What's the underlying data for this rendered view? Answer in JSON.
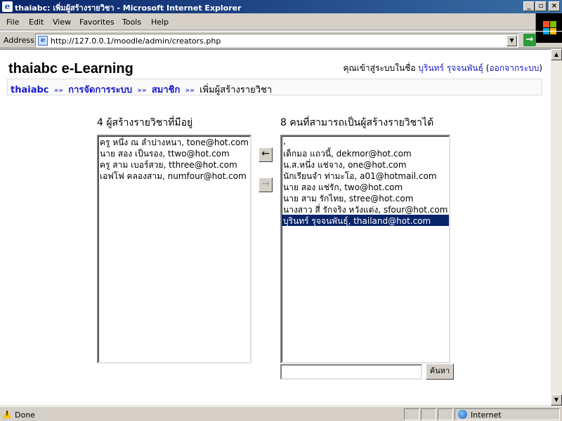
{
  "window": {
    "title": "thaiabc: เพิ่มผู้สร้างรายวิชา - Microsoft Internet Explorer",
    "minimize_glyph": "_",
    "maximize_glyph": "▫",
    "close_glyph": "×"
  },
  "menu": {
    "items": [
      "File",
      "Edit",
      "View",
      "Favorites",
      "Tools",
      "Help"
    ]
  },
  "address_bar": {
    "label": "Address",
    "url": "http://127.0.0.1/moodle/admin/creators.php",
    "go_label": "Go"
  },
  "page": {
    "site_title": "thaiabc e-Learning",
    "login": {
      "prefix": "คุณเข้าสู่ระบบในชื่อ",
      "user": "บุรินทร์ รุจจนพันธุ์",
      "logout": "ออกจากระบบ"
    },
    "breadcrumb": {
      "home": "thaiabc",
      "admin": "การจัดการระบบ",
      "users": "สมาชิก",
      "current": "เพิ่มผู้สร้างรายวิชา",
      "separator": "»»"
    },
    "existing": {
      "heading": "4 ผู้สร้างรายวิชาที่มีอยู่",
      "options": [
        "ครู หนึ่ง ณ ลำปางหนา, tone@hot.com",
        "นาย สอง เป็นรอง, ttwo@hot.com",
        "ครู สาม เบอร์สวย, tthree@hot.com",
        "เอฟโฟ คลองสาม, numfour@hot.com"
      ]
    },
    "potential": {
      "heading": "8 คนที่สามารถเป็นผู้สร้างรายวิชาได้",
      "options": [
        ",",
        "เด็กมอ แถวนี้, dekmor@hot.com",
        "น.ส.หนึ่ง แช่จาง, one@hot.com",
        "นักเรียนจำ ท่ามะโอ, a01@hotmail.com",
        "นาย สอง แช่รัก, two@hot.com",
        "นาย สาม รักไทย, stree@hot.com",
        "นางสาว สี่ รักจริง หวังแต่ง, sfour@hot.com",
        "บุรินทร์ รุจจนพันธุ์, thailand@hot.com"
      ],
      "selected_index": 7
    },
    "add_arrow": "←",
    "remove_arrow": "→",
    "search_button": "ค้นหา",
    "search_value": ""
  },
  "status_bar": {
    "text": "Done",
    "zone": "Internet"
  }
}
